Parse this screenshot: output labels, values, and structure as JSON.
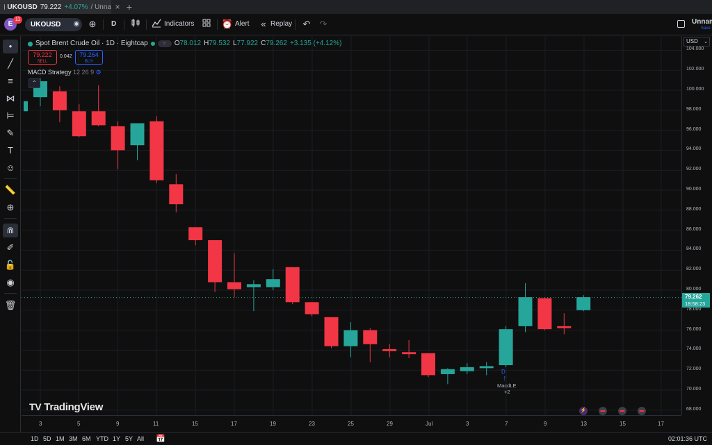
{
  "browser": {
    "tab_symbol": "UKOUSD",
    "tab_price": "79.222",
    "tab_change": "+4.07%",
    "tab_rest": "/ Unna",
    "tab_close": "×",
    "tab_add": "+"
  },
  "toolbar": {
    "avatar_letter": "E",
    "notification_count": "11",
    "symbol": "UKOUSD",
    "interval": "D",
    "indicators_label": "Indicators",
    "alert_label": "Alert",
    "replay_label": "Replay",
    "layout_name": "Unnam",
    "save_label": "Save"
  },
  "legend": {
    "title": "Spot Brent Crude Oil · 1D · Eightcap",
    "open_label": "O",
    "open": "78.012",
    "high_label": "H",
    "high": "79.532",
    "low_label": "L",
    "low": "77.922",
    "close_label": "C",
    "close": "79.262",
    "change": "+3.135 (+4.12%)",
    "sell_price": "79.222",
    "sell_label": "SELL",
    "spread": "0.042",
    "buy_price": "79.264",
    "buy_label": "BUY",
    "indicator_name": "MACD Strategy",
    "indicator_params": "12 26 9"
  },
  "brand": {
    "logo_text": "TradingView"
  },
  "price_axis": {
    "currency": "USD",
    "labels": [
      "104.000",
      "102.000",
      "100.000",
      "98.000",
      "96.000",
      "94.000",
      "92.000",
      "90.000",
      "88.000",
      "86.000",
      "84.000",
      "82.000",
      "80.000",
      "78.000",
      "76.000",
      "74.000",
      "72.000",
      "70.000",
      "68.000"
    ],
    "last_price": "79.262",
    "countdown": "18:58:23"
  },
  "time_axis": {
    "labels": [
      "3",
      "5",
      "9",
      "11",
      "15",
      "17",
      "19",
      "23",
      "25",
      "29",
      "Jul",
      "3",
      "7",
      "9",
      "13",
      "15",
      "17"
    ]
  },
  "signal": {
    "label": "MacdLE",
    "count": "+2"
  },
  "bottom": {
    "ranges": [
      "1D",
      "5D",
      "1M",
      "3M",
      "6M",
      "YTD",
      "1Y",
      "5Y",
      "All"
    ],
    "clock": "02:01:36 UTC"
  },
  "colors": {
    "up": "#26a69a",
    "down": "#f23645",
    "background": "#0f0f0f",
    "accent": "#2962ff"
  },
  "chart_data": {
    "type": "candlestick",
    "instrument": "Spot Brent Crude Oil",
    "interval": "1D",
    "ylim": [
      67,
      105
    ],
    "candles": [
      {
        "o": 99.3,
        "h": 101.2,
        "l": 98.4,
        "c": 100.9
      },
      {
        "o": 99.9,
        "h": 100.4,
        "l": 96.8,
        "c": 98.0
      },
      {
        "o": 97.9,
        "h": 98.6,
        "l": 95.3,
        "c": 95.4
      },
      {
        "o": 97.9,
        "h": 100.5,
        "l": 96.4,
        "c": 96.5
      },
      {
        "o": 96.4,
        "h": 96.9,
        "l": 92.1,
        "c": 94.0
      },
      {
        "o": 94.5,
        "h": 96.7,
        "l": 93.0,
        "c": 96.7
      },
      {
        "o": 96.9,
        "h": 97.4,
        "l": 90.7,
        "c": 91.0
      },
      {
        "o": 90.6,
        "h": 91.6,
        "l": 87.8,
        "c": 88.6
      },
      {
        "o": 86.3,
        "h": 86.3,
        "l": 84.5,
        "c": 85.0
      },
      {
        "o": 85.0,
        "h": 85.0,
        "l": 79.8,
        "c": 80.8
      },
      {
        "o": 80.8,
        "h": 83.7,
        "l": 79.3,
        "c": 80.1
      },
      {
        "o": 80.3,
        "h": 81.0,
        "l": 77.9,
        "c": 80.6
      },
      {
        "o": 80.3,
        "h": 82.1,
        "l": 80.0,
        "c": 81.1
      },
      {
        "o": 82.3,
        "h": 82.3,
        "l": 78.6,
        "c": 78.8
      },
      {
        "o": 78.8,
        "h": 78.8,
        "l": 77.4,
        "c": 77.6
      },
      {
        "o": 77.3,
        "h": 77.3,
        "l": 74.2,
        "c": 74.4
      },
      {
        "o": 74.4,
        "h": 76.8,
        "l": 73.3,
        "c": 76.0
      },
      {
        "o": 76.0,
        "h": 76.2,
        "l": 72.8,
        "c": 74.6
      },
      {
        "o": 74.1,
        "h": 74.6,
        "l": 73.3,
        "c": 73.9
      },
      {
        "o": 73.8,
        "h": 75.0,
        "l": 73.2,
        "c": 73.6
      },
      {
        "o": 73.7,
        "h": 73.7,
        "l": 71.3,
        "c": 71.5
      },
      {
        "o": 71.6,
        "h": 72.2,
        "l": 70.6,
        "c": 72.1
      },
      {
        "o": 71.9,
        "h": 72.7,
        "l": 71.6,
        "c": 72.3
      },
      {
        "o": 72.2,
        "h": 72.8,
        "l": 71.5,
        "c": 72.4
      },
      {
        "o": 72.5,
        "h": 76.4,
        "l": 72.3,
        "c": 76.1
      },
      {
        "o": 76.4,
        "h": 80.7,
        "l": 75.8,
        "c": 79.3
      },
      {
        "o": 79.2,
        "h": 79.3,
        "l": 76.0,
        "c": 76.1
      },
      {
        "o": 76.4,
        "h": 77.7,
        "l": 75.6,
        "c": 76.2
      },
      {
        "o": 78.0,
        "h": 79.5,
        "l": 77.9,
        "c": 79.3
      }
    ]
  }
}
